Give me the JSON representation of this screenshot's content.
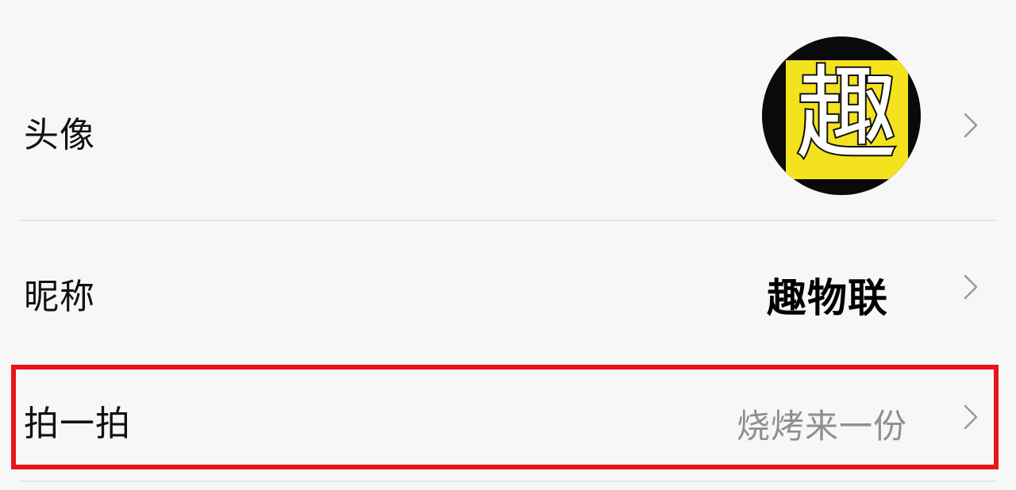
{
  "settings": {
    "rows": [
      {
        "label": "头像",
        "icon": "chevron-right-icon"
      },
      {
        "label": "昵称",
        "value": "趣物联",
        "icon": "chevron-right-icon"
      },
      {
        "label": "拍一拍",
        "value": "烧烤来一份",
        "icon": "chevron-right-icon"
      }
    ],
    "avatar": {
      "character": "趣",
      "colors": {
        "ring": "#0a0a0a",
        "tile": "#f4e21f",
        "glyph": "#ffffff"
      }
    }
  },
  "highlight": {
    "color": "#e8141b",
    "target_row": "拍一拍"
  }
}
